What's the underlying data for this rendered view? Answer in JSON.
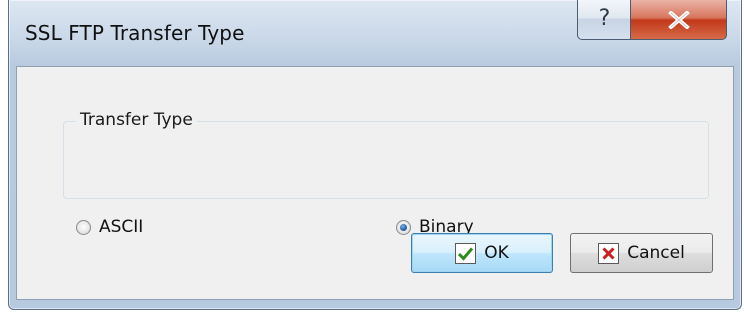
{
  "window": {
    "title": "SSL FTP Transfer Type",
    "help_glyph": "?"
  },
  "group": {
    "label": "Transfer Type",
    "options": [
      {
        "label": "ASCII",
        "selected": false
      },
      {
        "label": "Binary",
        "selected": true
      }
    ]
  },
  "buttons": {
    "ok_label": "OK",
    "cancel_label": "Cancel"
  },
  "icons": {
    "help": "help-icon",
    "close": "close-icon",
    "ok": "check-icon",
    "cancel": "x-mark-icon"
  },
  "colors": {
    "close_button": "#c7402a",
    "check_green": "#2e8b1e",
    "cancel_red": "#cc1f1f",
    "radio_selected": "#2c62a8"
  }
}
